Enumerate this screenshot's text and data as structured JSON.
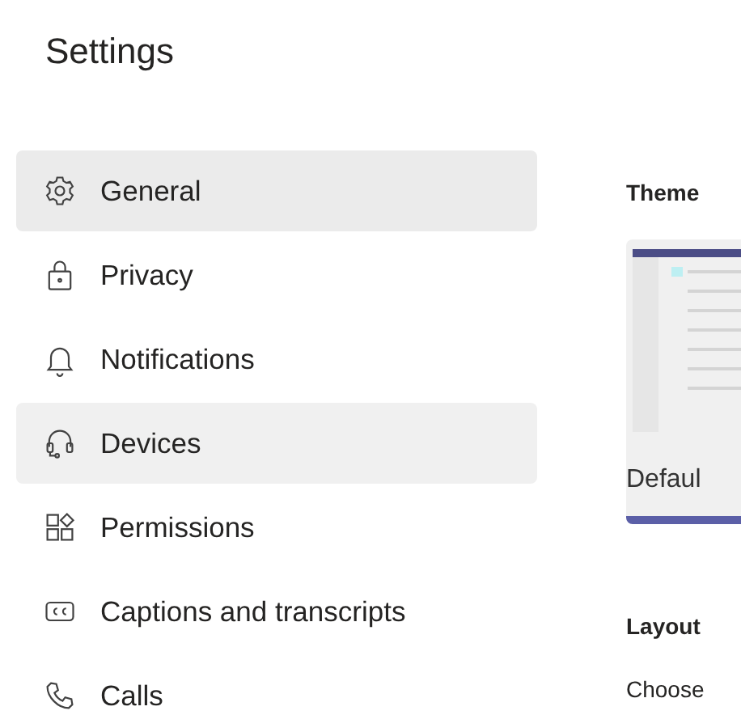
{
  "title": "Settings",
  "sidebar": {
    "items": [
      {
        "label": "General",
        "selected": true,
        "hovered": false
      },
      {
        "label": "Privacy",
        "selected": false,
        "hovered": false
      },
      {
        "label": "Notifications",
        "selected": false,
        "hovered": false
      },
      {
        "label": "Devices",
        "selected": false,
        "hovered": true
      },
      {
        "label": "Permissions",
        "selected": false,
        "hovered": false
      },
      {
        "label": "Captions and transcripts",
        "selected": false,
        "hovered": false
      },
      {
        "label": "Calls",
        "selected": false,
        "hovered": false
      }
    ]
  },
  "theme": {
    "heading": "Theme",
    "options": [
      {
        "label": "Defaul",
        "selected": true
      }
    ]
  },
  "layout": {
    "heading": "Layout",
    "description": "Choose"
  }
}
